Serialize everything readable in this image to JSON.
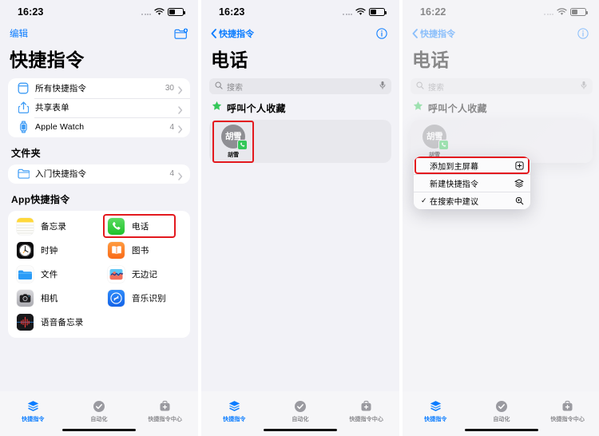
{
  "panels": [
    {
      "id": "shortcuts-home",
      "status": {
        "time": "16:23",
        "signal_icon": "signal-dots-icon",
        "wifi_icon": "wifi-icon",
        "battery_icon": "battery-icon"
      },
      "nav": {
        "edit_label": "编辑",
        "new_folder_icon": "new-folder-icon"
      },
      "title": "快捷指令",
      "list": [
        {
          "icon": "all-shortcuts-icon",
          "label": "所有快捷指令",
          "count": "30",
          "chevron": "chevron-right-icon"
        },
        {
          "icon": "share-sheet-icon",
          "label": "共享表单",
          "count": "",
          "chevron": "chevron-right-icon"
        },
        {
          "icon": "apple-watch-icon",
          "label": "Apple Watch",
          "count": "4",
          "chevron": "chevron-right-icon"
        }
      ],
      "folders_header": "文件夹",
      "folders": [
        {
          "icon": "folder-icon",
          "label": "入门快捷指令",
          "count": "4",
          "chevron": "chevron-right-icon"
        }
      ],
      "apps_header": "App快捷指令",
      "apps": [
        {
          "name": "备忘录",
          "icon": "notes-app-icon",
          "highlighted": false
        },
        {
          "name": "电话",
          "icon": "phone-app-icon",
          "highlighted": true
        },
        {
          "name": "时钟",
          "icon": "clock-app-icon",
          "highlighted": false
        },
        {
          "name": "图书",
          "icon": "books-app-icon",
          "highlighted": false
        },
        {
          "name": "文件",
          "icon": "files-app-icon",
          "highlighted": false
        },
        {
          "name": "无边记",
          "icon": "freeform-app-icon",
          "highlighted": false
        },
        {
          "name": "相机",
          "icon": "camera-app-icon",
          "highlighted": false
        },
        {
          "name": "音乐识别",
          "icon": "shazam-app-icon",
          "highlighted": false
        },
        {
          "name": "语音备忘录",
          "icon": "voice-memos-app-icon",
          "highlighted": false
        }
      ],
      "tabs": [
        {
          "label": "快捷指令",
          "icon": "shortcuts-tab-icon",
          "active": true
        },
        {
          "label": "自动化",
          "icon": "automation-tab-icon",
          "active": false
        },
        {
          "label": "快捷指令中心",
          "icon": "gallery-tab-icon",
          "active": false
        }
      ]
    },
    {
      "id": "phone-shortcuts",
      "status": {
        "time": "16:23",
        "signal_icon": "signal-dots-icon",
        "wifi_icon": "wifi-icon",
        "battery_icon": "battery-icon"
      },
      "nav": {
        "back_label": "快捷指令",
        "back_icon": "chevron-left-icon",
        "info_icon": "info-circle-icon"
      },
      "title": "电话",
      "search": {
        "placeholder": "搜索",
        "value": "",
        "search_icon": "search-icon",
        "mic_icon": "microphone-icon"
      },
      "section": {
        "icon": "star-icon",
        "label": "呼叫个人收藏"
      },
      "favorite": {
        "initials": "胡雪",
        "name": "胡雪",
        "badge_icon": "phone-badge-icon",
        "highlighted": true
      },
      "tabs": [
        {
          "label": "快捷指令",
          "icon": "shortcuts-tab-icon",
          "active": true
        },
        {
          "label": "自动化",
          "icon": "automation-tab-icon",
          "active": false
        },
        {
          "label": "快捷指令中心",
          "icon": "gallery-tab-icon",
          "active": false
        }
      ]
    },
    {
      "id": "phone-shortcuts-contextmenu",
      "status": {
        "time": "16:22",
        "signal_icon": "signal-dots-icon",
        "wifi_icon": "wifi-icon",
        "battery_icon": "battery-icon"
      },
      "nav": {
        "back_label": "快捷指令",
        "back_icon": "chevron-left-icon",
        "info_icon": "info-circle-icon"
      },
      "title": "电话",
      "search": {
        "placeholder": "搜索",
        "value": "",
        "search_icon": "search-icon",
        "mic_icon": "microphone-icon"
      },
      "section": {
        "icon": "star-icon",
        "label": "呼叫个人收藏"
      },
      "favorite": {
        "initials": "胡雪",
        "name": "胡雪",
        "badge_icon": "phone-badge-icon",
        "highlighted": false
      },
      "context_menu": [
        {
          "label": "添加到主屏幕",
          "icon": "add-to-home-screen-icon",
          "checked": false,
          "highlighted": true
        },
        {
          "label": "新建快捷指令",
          "icon": "new-shortcut-icon",
          "checked": false,
          "highlighted": false
        },
        {
          "label": "在搜索中建议",
          "icon": "search-suggest-icon",
          "checked": true,
          "highlighted": false
        }
      ],
      "tabs": [
        {
          "label": "快捷指令",
          "icon": "shortcuts-tab-icon",
          "active": true
        },
        {
          "label": "自动化",
          "icon": "automation-tab-icon",
          "active": false
        },
        {
          "label": "快捷指令中心",
          "icon": "gallery-tab-icon",
          "active": false
        }
      ]
    }
  ],
  "colors": {
    "accent_blue": "#0a7cff",
    "highlight_red": "#e3191e",
    "bg_gray": "#f2f2f7",
    "card_white": "#ffffff",
    "green": "#34c759",
    "muted": "#8a8a8e"
  }
}
